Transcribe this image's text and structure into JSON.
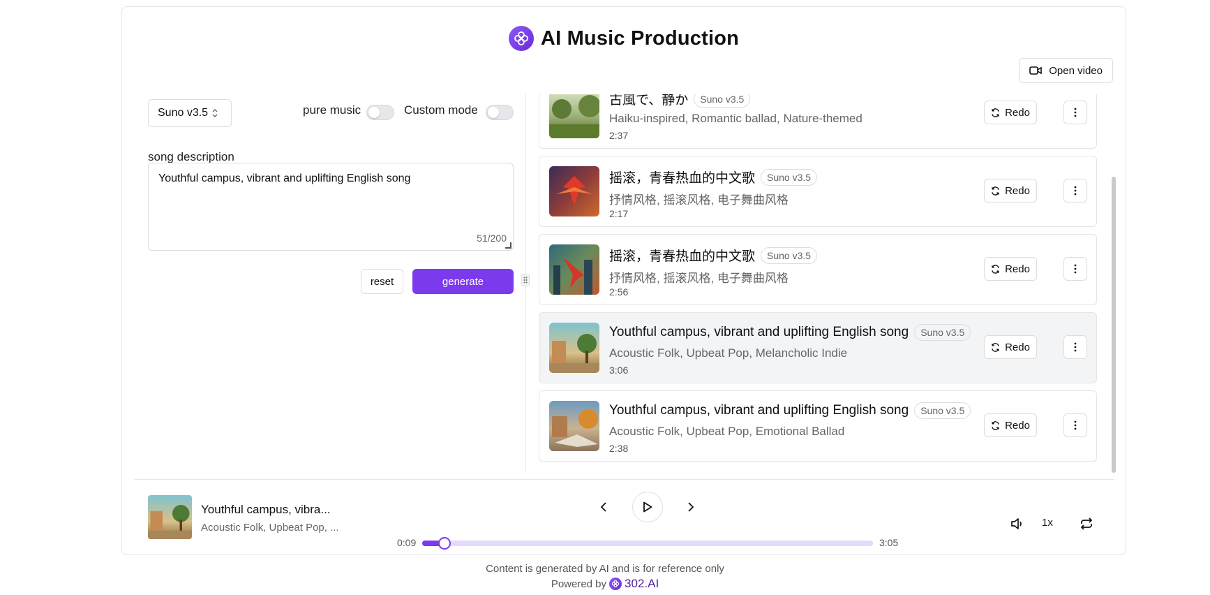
{
  "header": {
    "title": "AI Music Production"
  },
  "toolbar": {
    "open_video_label": "Open video"
  },
  "form": {
    "model": "Suno v3.5",
    "pure_music_label": "pure music",
    "pure_music_on": false,
    "custom_mode_label": "Custom mode",
    "custom_mode_on": false,
    "description_label": "song description",
    "description_value": "Youthful campus, vibrant and uplifting English song",
    "char_count": "51/200",
    "reset_label": "reset",
    "generate_label": "generate"
  },
  "songs": [
    {
      "title": "古風で、静か",
      "model": "Suno v3.5",
      "styles": "Haiku-inspired, Romantic ballad, Nature-themed",
      "duration": "2:37",
      "redo_label": "Redo"
    },
    {
      "title": "摇滚，青春热血的中文歌",
      "model": "Suno v3.5",
      "styles": "抒情风格, 摇滚风格, 电子舞曲风格",
      "duration": "2:17",
      "redo_label": "Redo"
    },
    {
      "title": "摇滚，青春热血的中文歌",
      "model": "Suno v3.5",
      "styles": "抒情风格, 摇滚风格, 电子舞曲风格",
      "duration": "2:56",
      "redo_label": "Redo"
    },
    {
      "title": "Youthful campus, vibrant and uplifting English song",
      "model": "Suno v3.5",
      "styles": "Acoustic Folk, Upbeat Pop, Melancholic Indie",
      "duration": "3:06",
      "redo_label": "Redo"
    },
    {
      "title": "Youthful campus, vibrant and uplifting English song",
      "model": "Suno v3.5",
      "styles": "Acoustic Folk, Upbeat Pop, Emotional Ballad",
      "duration": "2:38",
      "redo_label": "Redo"
    }
  ],
  "player": {
    "title": "Youthful campus, vibra...",
    "styles": "Acoustic Folk, Upbeat Pop, ...",
    "elapsed": "0:09",
    "total": "3:05",
    "progress": 0.049,
    "speed": "1x"
  },
  "footer": {
    "disclaimer": "Content is generated by AI and is for reference only",
    "powered_by": "Powered by",
    "brand": "302.AI"
  },
  "colors": {
    "accent": "#7c3aed",
    "track": "#e4d9fb"
  }
}
